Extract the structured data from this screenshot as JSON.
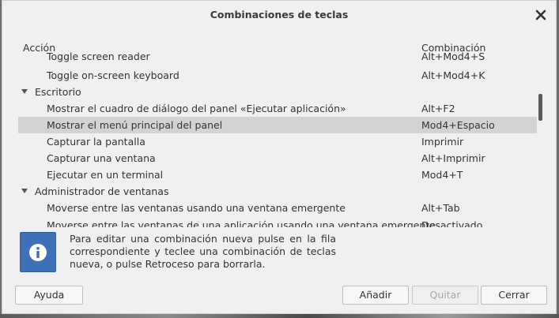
{
  "dialog": {
    "title": "Combinaciones de teclas"
  },
  "columns": {
    "action": "Acción",
    "combination": "Combinación"
  },
  "rows": [
    {
      "action": "Toggle screen reader",
      "key": "Alt+Mod4+S"
    },
    {
      "action": "Toggle on-screen keyboard",
      "key": "Alt+Mod4+K"
    },
    {
      "action": "Escritorio",
      "key": ""
    },
    {
      "action": "Mostrar el cuadro de diálogo del panel «Ejecutar aplicación»",
      "key": "Alt+F2"
    },
    {
      "action": "Mostrar el menú principal del panel",
      "key": "Mod4+Espacio"
    },
    {
      "action": "Capturar la pantalla",
      "key": "Imprimir"
    },
    {
      "action": "Capturar una ventana",
      "key": "Alt+Imprimir"
    },
    {
      "action": "Ejecutar en un terminal",
      "key": "Mod4+T"
    },
    {
      "action": "Administrador de ventanas",
      "key": ""
    },
    {
      "action": "Moverse entre las ventanas usando una ventana emergente",
      "key": "Alt+Tab"
    },
    {
      "action": "Moverse entre las ventanas de una aplicación usando una ventana emergente",
      "key": "Desactivado"
    }
  ],
  "info": {
    "text": "Para editar una combinación nueva pulse en la fila correspondiente y teclee una combinación de teclas nueva, o pulse Retroceso para borrarla."
  },
  "buttons": {
    "help": "Ayuda",
    "add": "Añadir",
    "remove": "Quitar",
    "close": "Cerrar"
  },
  "icons": {
    "close": "close-icon",
    "info": "info-icon",
    "expander": "expander-triangle-icon"
  },
  "colors": {
    "dialog_bg": "#f0f0f0",
    "selection": "#d3d3d3",
    "info_accent": "#3f6fb8"
  }
}
